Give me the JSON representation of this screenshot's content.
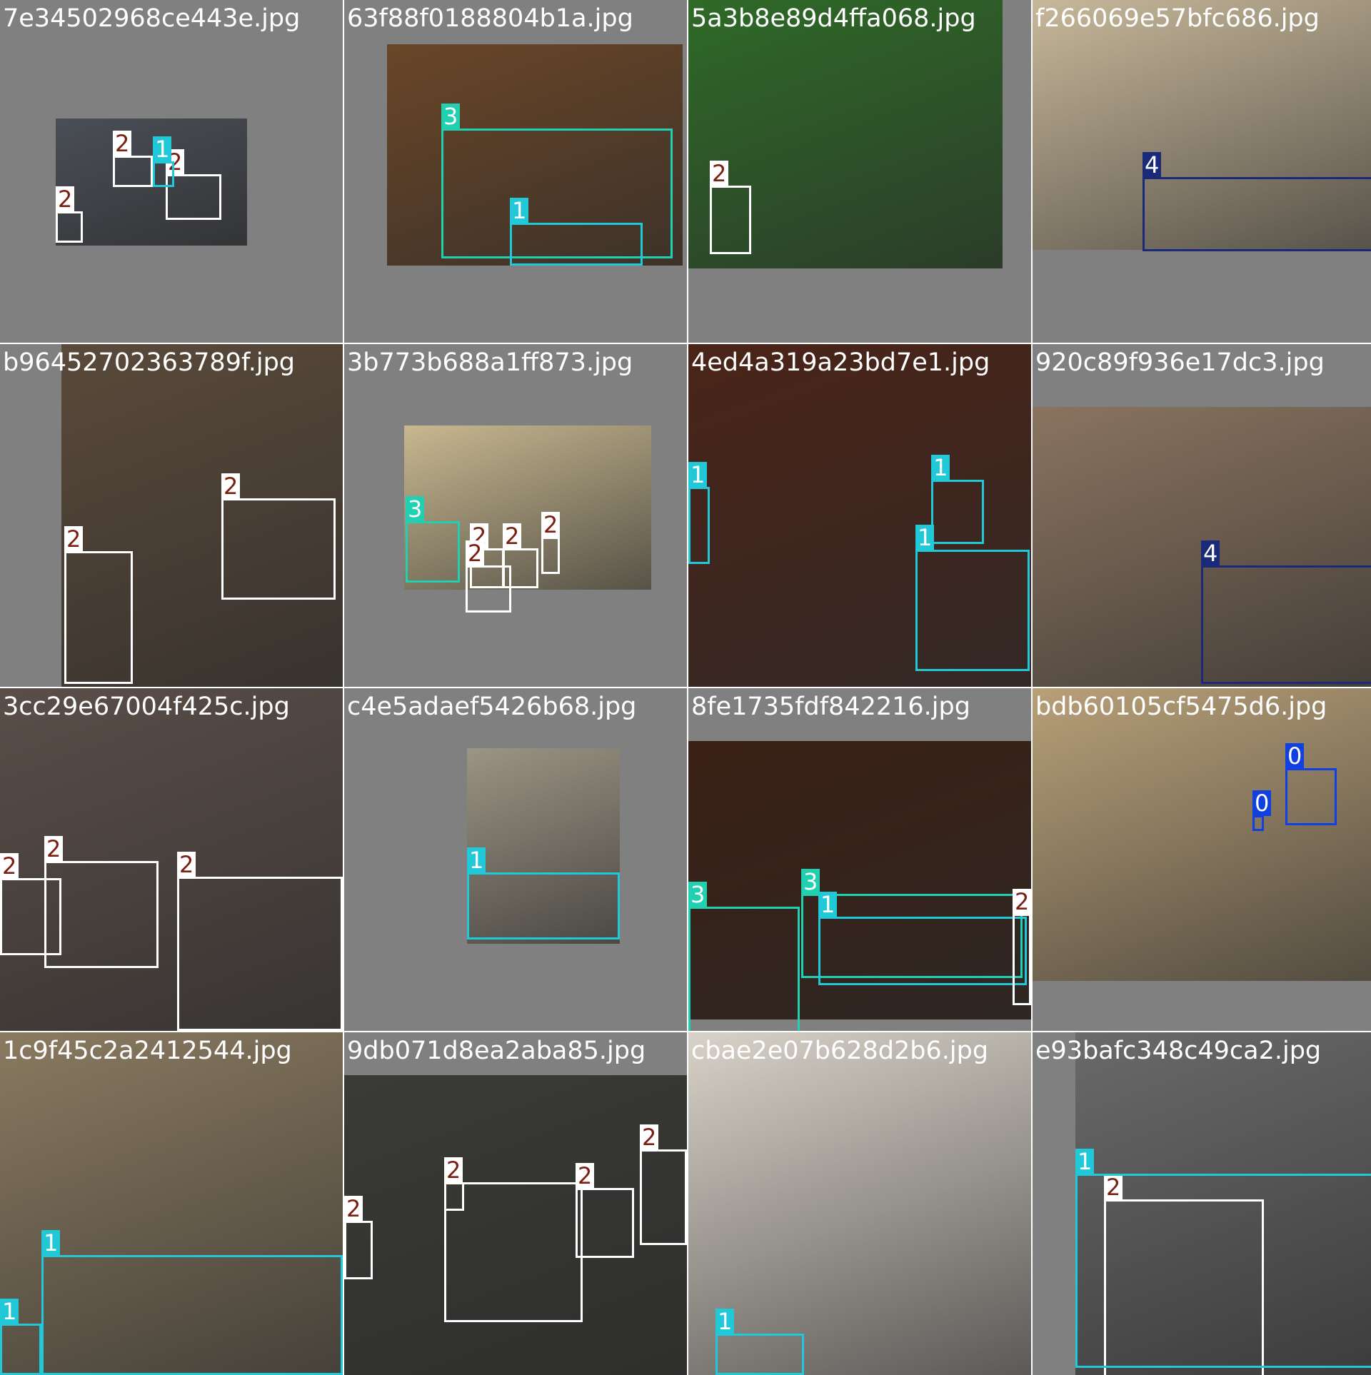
{
  "title": "",
  "class_colors": {
    "0": "#1040e0",
    "1": "#20c8d8",
    "2": "#ffffff",
    "3": "#20d0b0",
    "4": "#1a2a78"
  },
  "tiles": [
    {
      "file": "7e34502968ce443e.jpg",
      "boxes": [
        {
          "label": "2"
        },
        {
          "label": "2"
        },
        {
          "label": "2"
        },
        {
          "label": "1"
        }
      ]
    },
    {
      "file": "63f88f0188804b1a.jpg",
      "boxes": [
        {
          "label": "3"
        },
        {
          "label": "1"
        }
      ]
    },
    {
      "file": "5a3b8e89d4ffa068.jpg",
      "boxes": [
        {
          "label": "2"
        }
      ]
    },
    {
      "file": "f266069e57bfc686.jpg",
      "boxes": [
        {
          "label": "4"
        }
      ]
    },
    {
      "file": "b96452702363789f.jpg",
      "boxes": [
        {
          "label": "2"
        },
        {
          "label": "2"
        }
      ]
    },
    {
      "file": "3b773b688a1ff873.jpg",
      "boxes": [
        {
          "label": "3"
        },
        {
          "label": "2"
        },
        {
          "label": "2"
        },
        {
          "label": "2"
        },
        {
          "label": "2"
        }
      ]
    },
    {
      "file": "4ed4a319a23bd7e1.jpg",
      "boxes": [
        {
          "label": "1"
        },
        {
          "label": "1"
        },
        {
          "label": "1"
        }
      ]
    },
    {
      "file": "920c89f936e17dc3.jpg",
      "boxes": [
        {
          "label": "4"
        }
      ]
    },
    {
      "file": "3cc29e67004f425c.jpg",
      "boxes": [
        {
          "label": "2"
        },
        {
          "label": "2"
        },
        {
          "label": "2"
        }
      ]
    },
    {
      "file": "c4e5adaef5426b68.jpg",
      "boxes": [
        {
          "label": "1"
        }
      ]
    },
    {
      "file": "8fe1735fdf842216.jpg",
      "boxes": [
        {
          "label": "3"
        },
        {
          "label": "3"
        },
        {
          "label": "1"
        },
        {
          "label": "2"
        }
      ]
    },
    {
      "file": "bdb60105cf5475d6.jpg",
      "boxes": [
        {
          "label": "0"
        },
        {
          "label": "0"
        }
      ]
    },
    {
      "file": "1c9f45c2a2412544.jpg",
      "boxes": [
        {
          "label": "1"
        },
        {
          "label": "1"
        }
      ]
    },
    {
      "file": "9db071d8ea2aba85.jpg",
      "boxes": [
        {
          "label": "2"
        },
        {
          "label": "2"
        },
        {
          "label": "2"
        },
        {
          "label": "2"
        },
        {
          "label": "2"
        }
      ]
    },
    {
      "file": "cbae2e07b628d2b6.jpg",
      "boxes": [
        {
          "label": "1"
        }
      ]
    },
    {
      "file": "e93bafc348c49ca2.jpg",
      "boxes": [
        {
          "label": "2"
        },
        {
          "label": "1"
        }
      ]
    }
  ]
}
